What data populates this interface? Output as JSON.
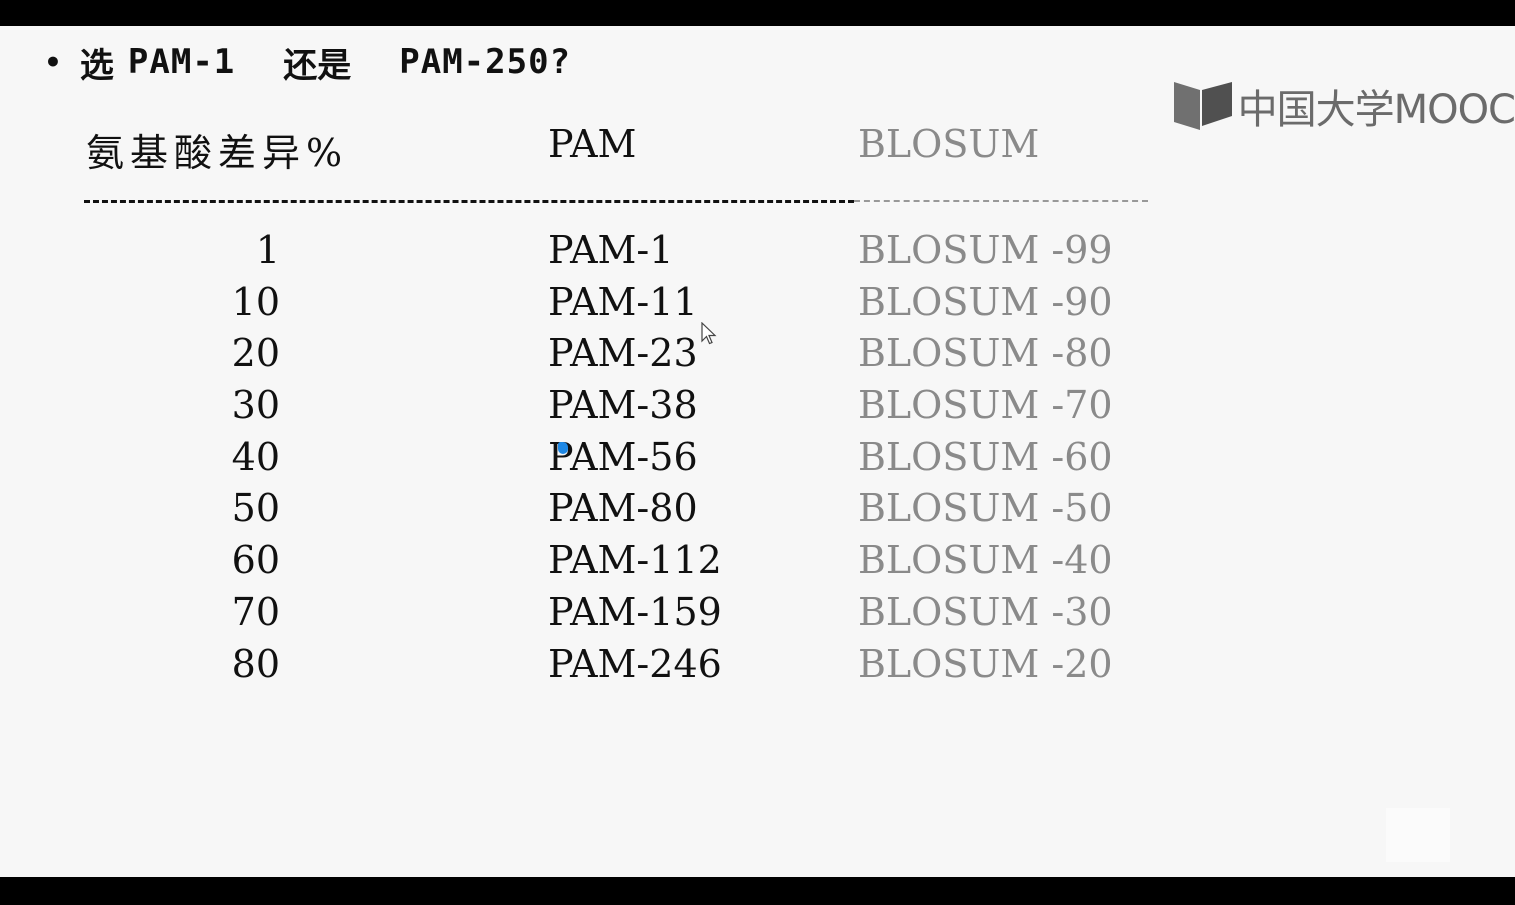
{
  "title": {
    "bullet": "•",
    "part1": "选",
    "part2": "PAM-1",
    "part3": "还是",
    "part4": "PAM-250?"
  },
  "logo": {
    "text": "中国大学MOOC",
    "icon": "mooc-book-logo-icon",
    "color": "#6b6b6b"
  },
  "table": {
    "headers": {
      "diff": "氨基酸差异%",
      "pam": "PAM",
      "blosum": "BLOSUM"
    },
    "rows": [
      {
        "diff": "1",
        "pam": "PAM-1",
        "blosum": "BLOSUM -99"
      },
      {
        "diff": "10",
        "pam": "PAM-11",
        "blosum": "BLOSUM -90"
      },
      {
        "diff": "20",
        "pam": "PAM-23",
        "blosum": "BLOSUM -80"
      },
      {
        "diff": "30",
        "pam": "PAM-38",
        "blosum": "BLOSUM -70"
      },
      {
        "diff": "40",
        "pam": "PAM-56",
        "blosum": "BLOSUM -60"
      },
      {
        "diff": "50",
        "pam": "PAM-80",
        "blosum": "BLOSUM -50"
      },
      {
        "diff": "60",
        "pam": "PAM-112",
        "blosum": "BLOSUM -40"
      },
      {
        "diff": "70",
        "pam": "PAM-159",
        "blosum": "BLOSUM -30"
      },
      {
        "diff": "80",
        "pam": "PAM-246",
        "blosum": "BLOSUM -20"
      }
    ]
  },
  "colors": {
    "text": "#111111",
    "blosum_text": "#8a8a8a",
    "slide_bg": "#f7f7f7",
    "frame": "#000000"
  },
  "cursors": [
    "mouse-cursor-icon",
    "pointer-dot-icon"
  ]
}
